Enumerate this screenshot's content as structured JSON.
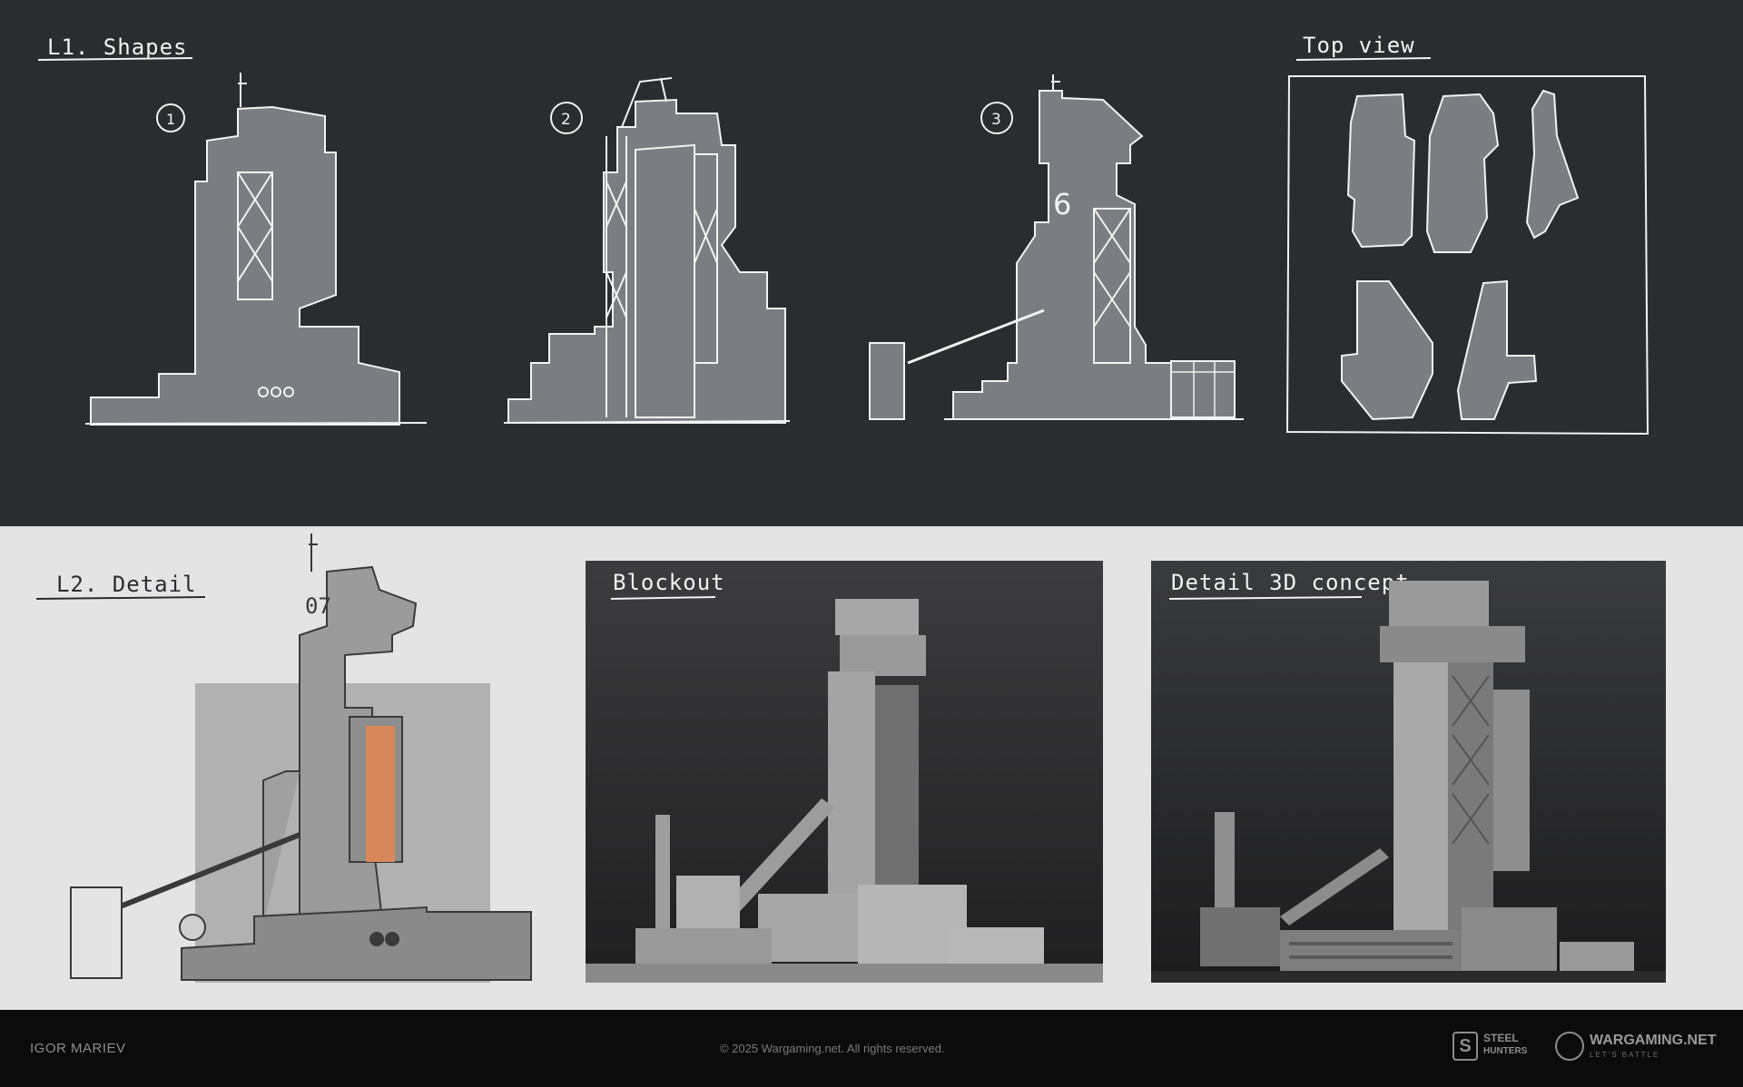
{
  "labels": {
    "shapes_title": "L1. Shapes",
    "top_view_title": "Top view",
    "detail_title": "L2. Detail",
    "blockout_title": "Blockout",
    "concept_title": "Detail 3D concept",
    "sketch_numbers": [
      "1",
      "2",
      "3"
    ],
    "painted_number_sketch3": "6",
    "painted_number_detail": "07"
  },
  "footer": {
    "author": "IGOR MARIEV",
    "copyright": "© 2025 Wargaming.net. All rights reserved.",
    "logo_steel_top": "STEEL",
    "logo_steel_bottom": "HUNTERS",
    "logo_wg": "WARGAMING.NET",
    "logo_wg_tagline": "LET'S BATTLE"
  },
  "colors": {
    "dark_panel": "#2b2c2f",
    "light_panel": "#e4e4e4",
    "sketch_fill": "#7b7d82",
    "chalk_line": "#f2f2f2",
    "accent_orange": "#d8885a"
  }
}
